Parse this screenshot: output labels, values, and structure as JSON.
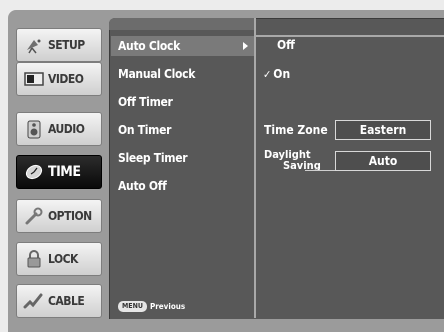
{
  "tabs": [
    {
      "label": "SETUP",
      "icon": "satellite-dish-icon"
    },
    {
      "label": "VIDEO",
      "icon": "tv-screen-icon"
    },
    {
      "label": "AUDIO",
      "icon": "speaker-icon"
    },
    {
      "label": "TIME",
      "icon": "clock-icon"
    },
    {
      "label": "OPTION",
      "icon": "wrench-icon"
    },
    {
      "label": "LOCK",
      "icon": "padlock-icon"
    },
    {
      "label": "CABLE",
      "icon": "cable-plug-icon"
    }
  ],
  "active_tab": "TIME",
  "menu": {
    "items": [
      "Auto Clock",
      "Manual Clock",
      "Off Timer",
      "On Timer",
      "Sleep Timer",
      "Auto Off"
    ],
    "selected": "Auto Clock"
  },
  "options": {
    "off": "Off",
    "on": "On",
    "checked": "On"
  },
  "settings": {
    "time_zone_label": "Time Zone",
    "time_zone_value": "Eastern",
    "daylight_label_line1": "Daylight",
    "daylight_label_line2": "Saving",
    "daylight_value": "Auto"
  },
  "footer": {
    "key": "MENU",
    "text": "Previous"
  },
  "colors": {
    "frame": "#9b9b9b",
    "panel": "#585858",
    "highlight": "#7a7a7a",
    "active_tab": "#111111"
  }
}
